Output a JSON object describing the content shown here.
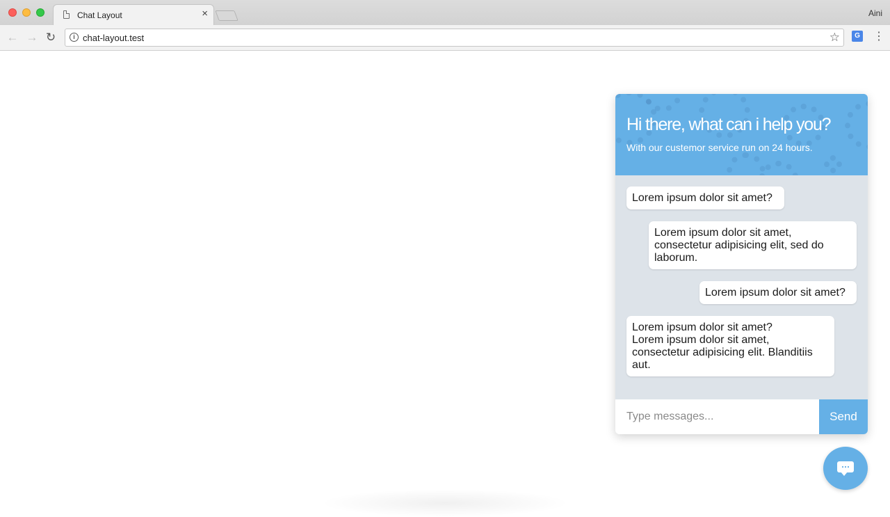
{
  "browser": {
    "tab_title": "Chat Layout",
    "tab_close": "×",
    "profile_name": "Aini",
    "url": "chat-layout.test",
    "icons": [
      "back-arrow-icon",
      "forward-arrow-icon",
      "reload-icon",
      "info-icon",
      "star-icon",
      "translate-icon",
      "menu-icon"
    ]
  },
  "chat": {
    "title": "Hi there, what can i help you?",
    "subtitle": "With our custemor service run on 24 hours.",
    "messages": [
      {
        "lines": [
          "Lorem ipsum dolor sit amet?"
        ]
      },
      {
        "lines": [
          "Lorem ipsum dolor sit amet,",
          "consectetur adipisicing elit, sed do",
          "laborum."
        ]
      },
      {
        "lines": [
          "Lorem ipsum dolor sit amet?"
        ]
      },
      {
        "lines": [
          "Lorem ipsum dolor sit amet?",
          "Lorem ipsum dolor sit amet,",
          "consectetur adipisicing elit. Blanditiis",
          "aut."
        ]
      }
    ],
    "input_placeholder": "Type messages...",
    "send_label": "Send"
  },
  "colors": {
    "accent": "#65b0e6",
    "chat_background": "#dde3e9"
  }
}
